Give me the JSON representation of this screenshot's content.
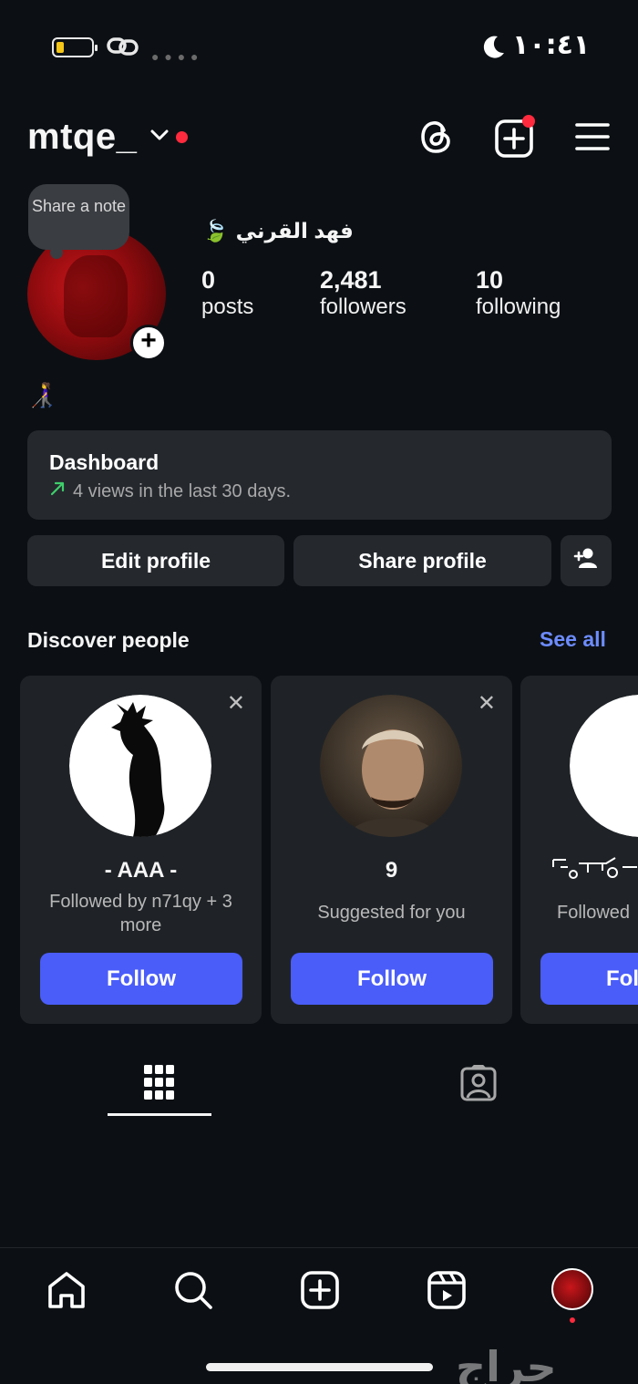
{
  "status_bar": {
    "time": "١٠:٤١",
    "battery_icon": "battery-low-icon",
    "link_icon": "link-icon",
    "moon_icon": "moon-icon"
  },
  "header": {
    "username": "mtqe_",
    "menu_icons": [
      "threads-icon",
      "create-post-icon",
      "hamburger-menu-icon"
    ]
  },
  "note": {
    "text": "Share a note"
  },
  "profile": {
    "full_name": "فهد القرني",
    "name_emoji": "🍃",
    "stats": [
      {
        "value": "0",
        "label": "posts"
      },
      {
        "value": "2,481",
        "label": "followers"
      },
      {
        "value": "10",
        "label": "following"
      }
    ],
    "bio_emoji": "👩‍🦯"
  },
  "dashboard": {
    "title": "Dashboard",
    "subtitle": "4 views in the last 30 days."
  },
  "buttons": {
    "edit": "Edit profile",
    "share": "Share profile"
  },
  "discover": {
    "title": "Discover people",
    "see_all": "See all",
    "cards": [
      {
        "name": "- AAA -",
        "subtitle": "Followed by n71qy + 3 more",
        "follow": "Follow"
      },
      {
        "name": "9",
        "subtitle": "Suggested for you",
        "follow": "Follow"
      },
      {
        "name": "",
        "subtitle": "Followed",
        "follow": "Fol"
      }
    ]
  },
  "tabs": [
    "grid-icon",
    "tagged-icon"
  ],
  "bottom_nav": [
    "home-icon",
    "search-icon",
    "create-icon",
    "reels-icon",
    "profile-avatar"
  ],
  "watermark": "حراج",
  "colors": {
    "background": "#0c1014",
    "accent": "#4a5df9",
    "link": "#6d8cff",
    "notification": "#ff2a3d"
  }
}
